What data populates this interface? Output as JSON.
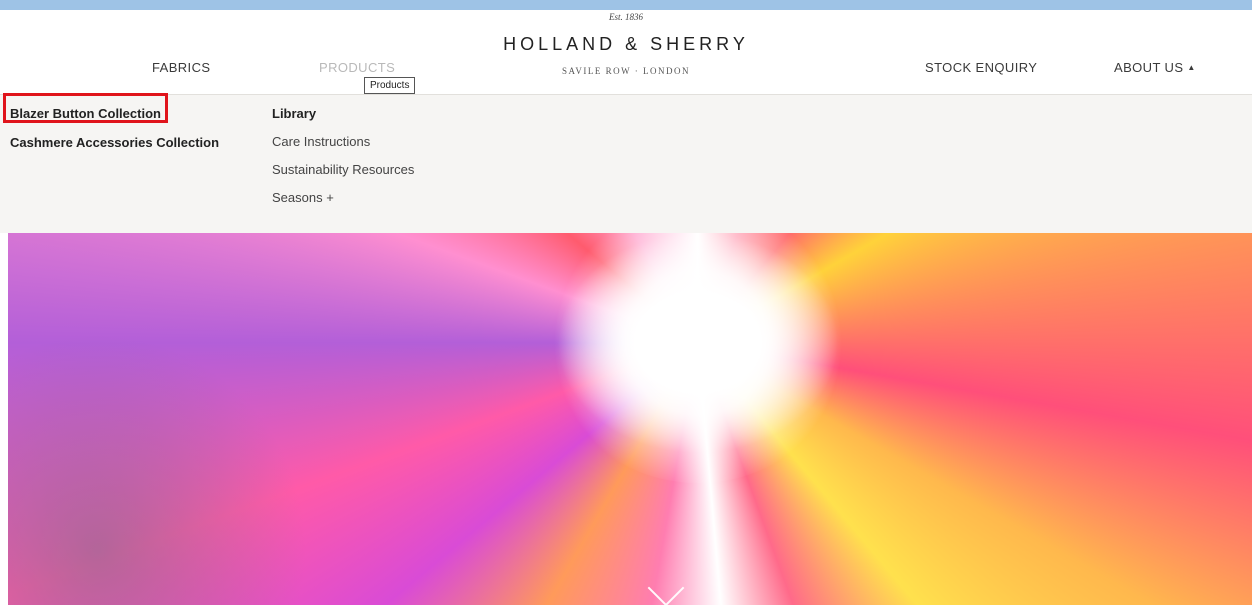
{
  "logo": {
    "est": "Est. 1836",
    "name": "HOLLAND & SHERRY",
    "tagline": "SAVILE ROW · LONDON"
  },
  "nav": {
    "fabrics": "FABRICS",
    "products": "PRODUCTS",
    "stock_enquiry": "STOCK ENQUIRY",
    "about_us": "ABOUT US",
    "about_caret": "▲"
  },
  "tooltip": "Products",
  "dropdown": {
    "col1": [
      "Blazer Button Collection",
      "Cashmere Accessories Collection"
    ],
    "col2": [
      "Library",
      "Care Instructions",
      "Sustainability Resources",
      "Seasons +"
    ]
  },
  "hero": {
    "scroll_icon": "chevron-down-icon"
  }
}
